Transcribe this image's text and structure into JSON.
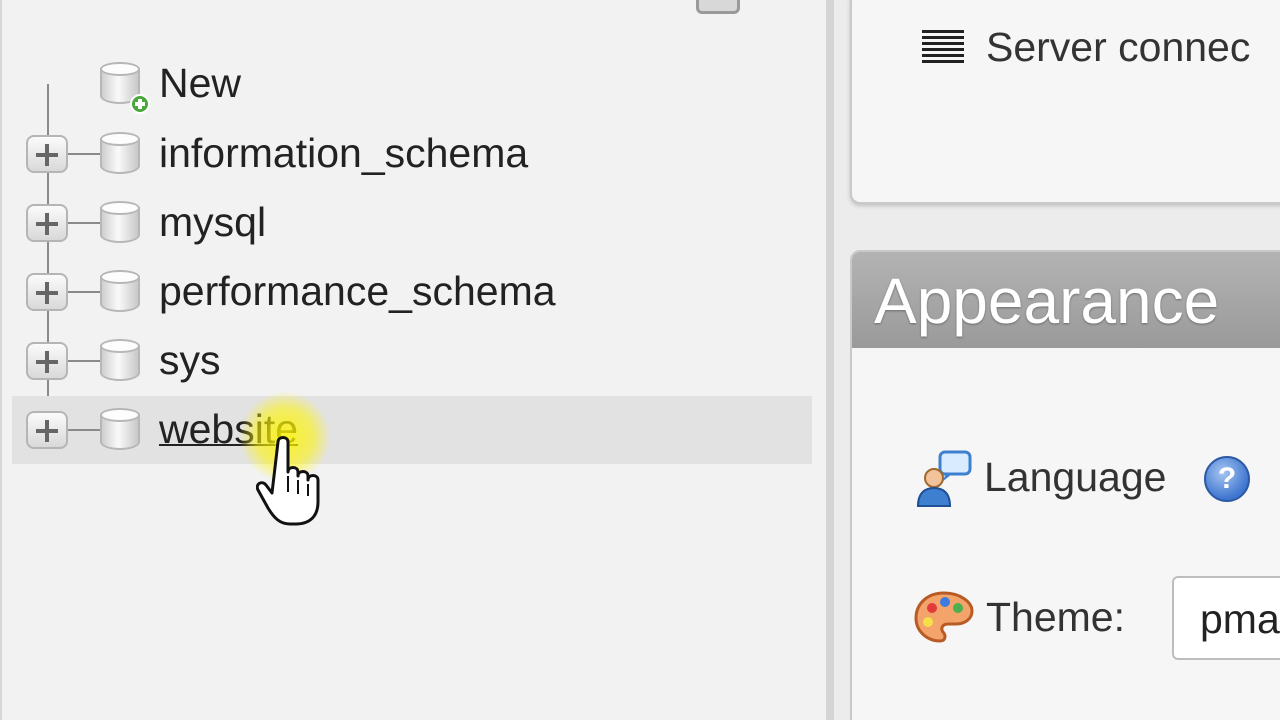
{
  "navigation": {
    "items": [
      {
        "label": "New",
        "type": "new"
      },
      {
        "label": "information_schema",
        "type": "database"
      },
      {
        "label": "mysql",
        "type": "database"
      },
      {
        "label": "performance_schema",
        "type": "database"
      },
      {
        "label": "sys",
        "type": "database"
      },
      {
        "label": "website",
        "type": "database",
        "hovered": true
      }
    ]
  },
  "server_panel": {
    "text": "Server connec",
    "icon": "list-icon"
  },
  "appearance": {
    "title": "Appearance",
    "language_label": "Language",
    "help_icon": "?",
    "theme_label": "Theme:",
    "theme_value": "pma"
  },
  "colors": {
    "highlight": "#e2e2e2",
    "cursor_glow": "#fff500",
    "help_blue": "#3f76cf",
    "new_badge": "#4aa93b"
  }
}
